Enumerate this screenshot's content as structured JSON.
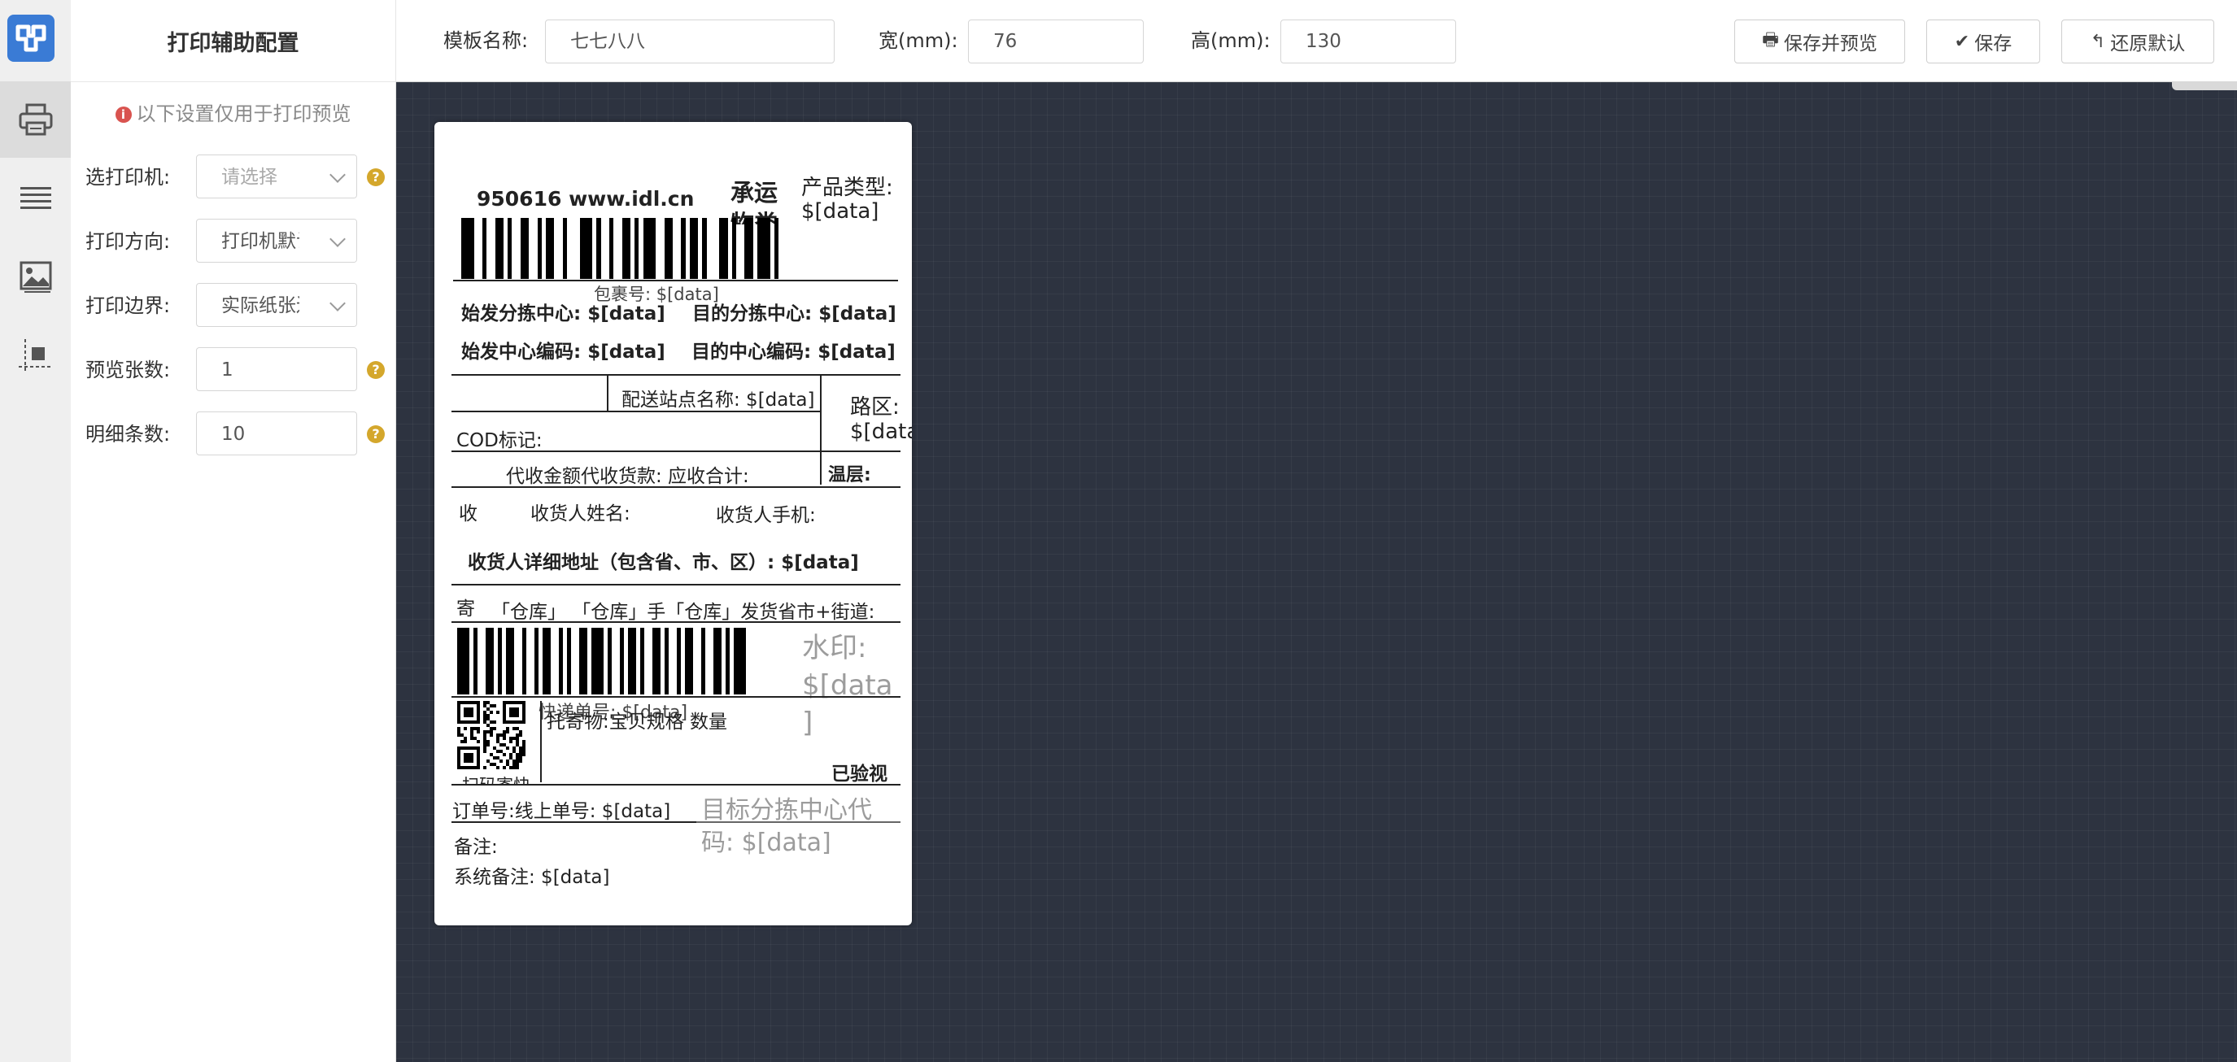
{
  "sidebar": {
    "tools": [
      "printer-icon",
      "list-icon",
      "image-icon",
      "align-icon"
    ]
  },
  "panel": {
    "title": "打印辅助配置",
    "note": "以下设置仅用于打印预览",
    "fields": [
      {
        "label": "选打印机:",
        "value": "请选择",
        "placeholder": true,
        "select": true,
        "help": true
      },
      {
        "label": "打印方向:",
        "value": "打印机默认",
        "select": true,
        "help": false
      },
      {
        "label": "打印边界:",
        "value": "实际纸张边界",
        "select": true,
        "help": false
      },
      {
        "label": "预览张数:",
        "value": "1",
        "select": false,
        "help": true
      },
      {
        "label": "明细条数:",
        "value": "10",
        "select": false,
        "help": true
      }
    ]
  },
  "toolbar": {
    "template_name_label": "模板名称:",
    "template_name_value": "七七八八",
    "width_label": "宽(mm):",
    "width_value": "76",
    "height_label": "高(mm):",
    "height_value": "130",
    "save_preview_label": "保存并预览",
    "save_label": "保存",
    "restore_label": "还原默认"
  },
  "label": {
    "header_text": "950616 www.idl.cn",
    "carrier_line1": "承运",
    "carrier_line2": "物类",
    "product_type_label": "产品类型:",
    "product_type_value": "$[data]",
    "package_no": "包裹号: $[data]",
    "origin_center": "始发分拣中心: $[data]",
    "dest_center": "目的分拣中心: $[data]",
    "origin_code": "始发中心编码: $[data]",
    "dest_code": "目的中心编码: $[data]",
    "delivery_station": "配送站点名称: $[data]",
    "route_label": "路区:",
    "route_value": "$[data]",
    "cod_label": "COD标记:",
    "amount_row": "代收金额代收货款: 应收合计:",
    "temperature": "温层:",
    "receiver_tag": "收",
    "receiver_name": "收货人姓名:",
    "receiver_phone": "收货人手机:",
    "receiver_address": "收货人详细地址（包含省、市、区）: $[data]",
    "sender_tag": "寄",
    "sender_line": "「仓库」 「仓库」手「仓库」发货省市+街道:",
    "watermark_line1": "水印:",
    "watermark_line2": "$[data",
    "watermark_line3": "]",
    "express_no": "快递单号: $[data]",
    "goods": "托寄物:宝贝规格 数量",
    "scan_text": "扫码寄快",
    "inspected": "已验视",
    "order_no": "订单号:线上单号: $[data]",
    "target_code_line1": "目标分拣中心代",
    "target_code_line2": "码: $[data]",
    "remark": "备注:",
    "system_remark": "系统备注: $[data]"
  },
  "colors": {
    "logo": "#3a7bd5",
    "canvas": "#2d3340",
    "info_icon": "#d9534f",
    "help_icon": "#d4a72c"
  }
}
